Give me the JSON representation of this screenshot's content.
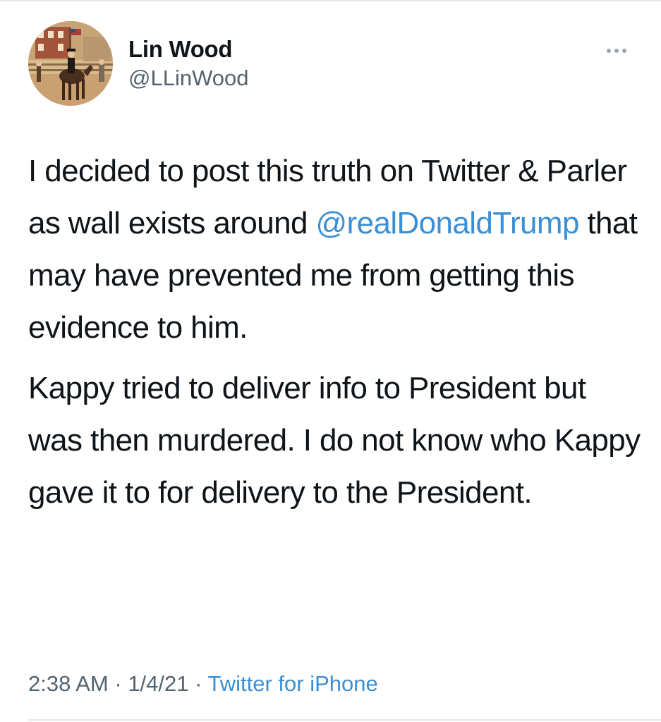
{
  "author": {
    "display_name": "Lin Wood",
    "handle": "@LLinWood",
    "avatar_icon": "avatar-horse-rider-painting"
  },
  "more_icon": "more-dots-icon",
  "tweet": {
    "paragraph_1": {
      "text_before": "I decided to post this truth on Twitter & Parler as wall exists around ",
      "mention": "@realDonaldTrump",
      "text_after": " that may have prevented me from getting this evidence to him."
    },
    "paragraph_2": "Kappy tried to deliver info to President but was then murdered. I do not know who Kappy gave it to for delivery to the President."
  },
  "meta": {
    "time": "2:38 AM",
    "separator_1": " · ",
    "date": "1/4/21",
    "separator_2": " · ",
    "source": "Twitter for iPhone"
  },
  "colors": {
    "text": "#0f1419",
    "secondary": "#536471",
    "link": "#3b8fd4"
  }
}
